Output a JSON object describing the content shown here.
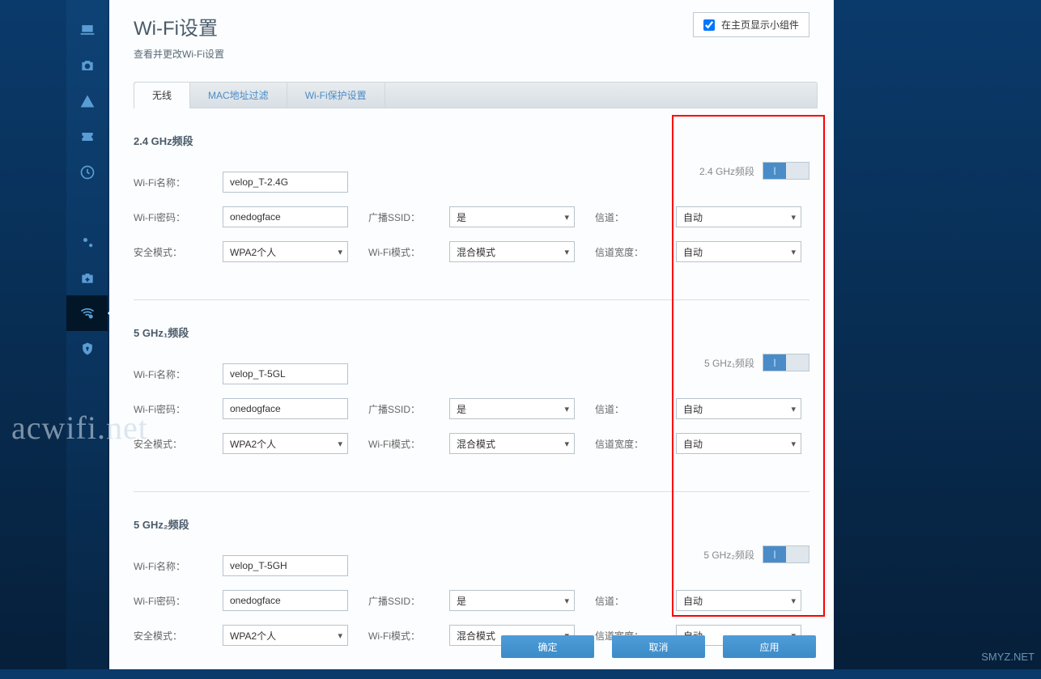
{
  "header": {
    "title": "Wi-Fi设置",
    "subtitle": "查看并更改Wi-Fi设置",
    "widget_checkbox_label": "在主页显示小组件"
  },
  "tabs": {
    "wireless": "无线",
    "mac_filter": "MAC地址过滤",
    "wps": "Wi-Fi保护设置"
  },
  "labels": {
    "wifi_name": "Wi-Fi名称：",
    "wifi_password": "Wi-Fi密码：",
    "security_mode": "安全模式：",
    "broadcast_ssid": "广播SSID：",
    "wifi_mode": "Wi-Fi模式：",
    "channel": "信道：",
    "channel_width": "信道宽度："
  },
  "options": {
    "yes": "是",
    "mixed": "混合模式",
    "auto": "自动",
    "wpa2_personal": "WPA2个人"
  },
  "bands": [
    {
      "title": "2.4 GHz频段",
      "toggle_label": "2.4 GHz频段",
      "name": "velop_T-2.4G",
      "password": "onedogface"
    },
    {
      "title": "5 GHz₁频段",
      "toggle_label": "5 GHz₁频段",
      "name": "velop_T-5GL",
      "password": "onedogface"
    },
    {
      "title": "5 GHz₂频段",
      "toggle_label": "5 GHz₂频段",
      "name": "velop_T-5GH",
      "password": "onedogface"
    }
  ],
  "buttons": {
    "ok": "确定",
    "cancel": "取消",
    "apply": "应用"
  },
  "toggle_on": "|",
  "watermarks": {
    "w1": "acwifi.net",
    "w2": "SMYZ.NET"
  }
}
